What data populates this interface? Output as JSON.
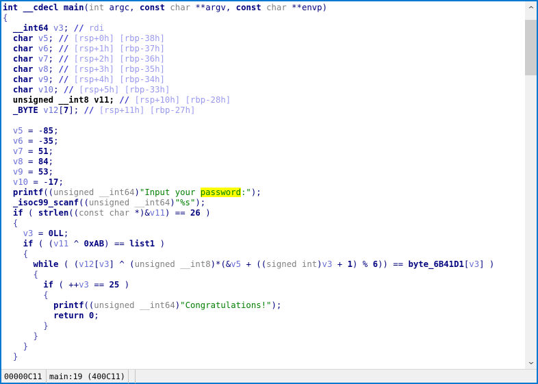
{
  "window": {
    "title": "Pseudocode-A",
    "accent_color": "#0a78d0",
    "background": "#ffffff"
  },
  "statusbar": {
    "address": "00000C11",
    "location": "main:19 (400C11)",
    "empty_1": "",
    "empty_2": ""
  },
  "scrollbar": {
    "up_arrow": "chevron-up-icon",
    "down_arrow": "chevron-down-icon",
    "thumb_top_pct": 2,
    "thumb_height_pct": 16
  },
  "highlight": {
    "word": "password",
    "color": "#ffff00"
  },
  "code": {
    "language": "c-pseudocode",
    "lines": [
      "int __cdecl main(int argc, const char **argv, const char **envp)",
      "{",
      "  __int64 v3; // rdi",
      "  char v5; // [rsp+0h] [rbp-38h]",
      "  char v6; // [rsp+1h] [rbp-37h]",
      "  char v7; // [rsp+2h] [rbp-36h]",
      "  char v8; // [rsp+3h] [rbp-35h]",
      "  char v9; // [rsp+4h] [rbp-34h]",
      "  char v10; // [rsp+5h] [rbp-33h]",
      "  unsigned __int8 v11; // [rsp+10h] [rbp-28h]",
      "  _BYTE v12[7]; // [rsp+11h] [rbp-27h]",
      "",
      "  v5 = -85;",
      "  v6 = -35;",
      "  v7 = 51;",
      "  v8 = 84;",
      "  v9 = 53;",
      "  v10 = -17;",
      "  printf((unsigned __int64)\"Input your password:\");",
      "  _isoc99_scanf((unsigned __int64)\"%s\");",
      "  if ( strlen((const char *)&v11) == 26 )",
      "  {",
      "    v3 = 0LL;",
      "    if ( (v11 ^ 0xAB) == list1 )",
      "    {",
      "      while ( (v12[v3] ^ (unsigned __int8)*(&v5 + ((signed int)v3 + 1) % 6)) == byte_6B41D1[v3] )",
      "      {",
      "        if ( ++v3 == 25 )",
      "        {",
      "          printf((unsigned __int64)\"Congratulations!\");",
      "          return 0;",
      "        }",
      "      }",
      "    }",
      "  }"
    ],
    "variables": [
      "v3",
      "v5",
      "v6",
      "v7",
      "v8",
      "v9",
      "v10",
      "v11",
      "v12"
    ],
    "strings": [
      "Input your password:",
      "%s",
      "Congratulations!"
    ],
    "functions": [
      "main",
      "printf",
      "_isoc99_scanf",
      "strlen"
    ],
    "globals": [
      "list1",
      "byte_6B41D1"
    ],
    "constants": [
      "-85",
      "-35",
      "51",
      "84",
      "53",
      "-17",
      "26",
      "0LL",
      "0xAB",
      "6",
      "25",
      "0",
      "7"
    ]
  }
}
